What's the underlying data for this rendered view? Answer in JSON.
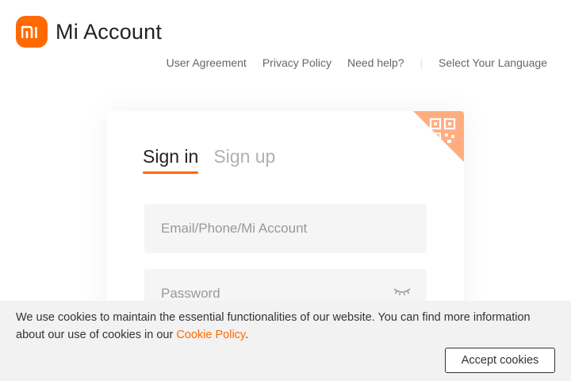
{
  "brand": {
    "logo_text": "mi",
    "title": "Mi Account",
    "accent_color": "#ff6900"
  },
  "topnav": {
    "items": [
      "User Agreement",
      "Privacy Policy",
      "Need help?"
    ],
    "separator": "|",
    "language": "Select Your Language"
  },
  "login": {
    "tabs": [
      {
        "label": "Sign in",
        "active": true
      },
      {
        "label": "Sign up",
        "active": false
      }
    ],
    "qr_icon": "qr-code-icon",
    "fields": {
      "account_placeholder": "Email/Phone/Mi Account",
      "password_placeholder": "Password"
    },
    "password_toggle_icon": "eye-closed-icon"
  },
  "cookie_banner": {
    "text_before": "We use cookies to maintain the essential functionalities of our website. You can find more information about our use of cookies in our ",
    "link_text": "Cookie Policy",
    "text_after": ".",
    "accept_label": "Accept cookies"
  }
}
